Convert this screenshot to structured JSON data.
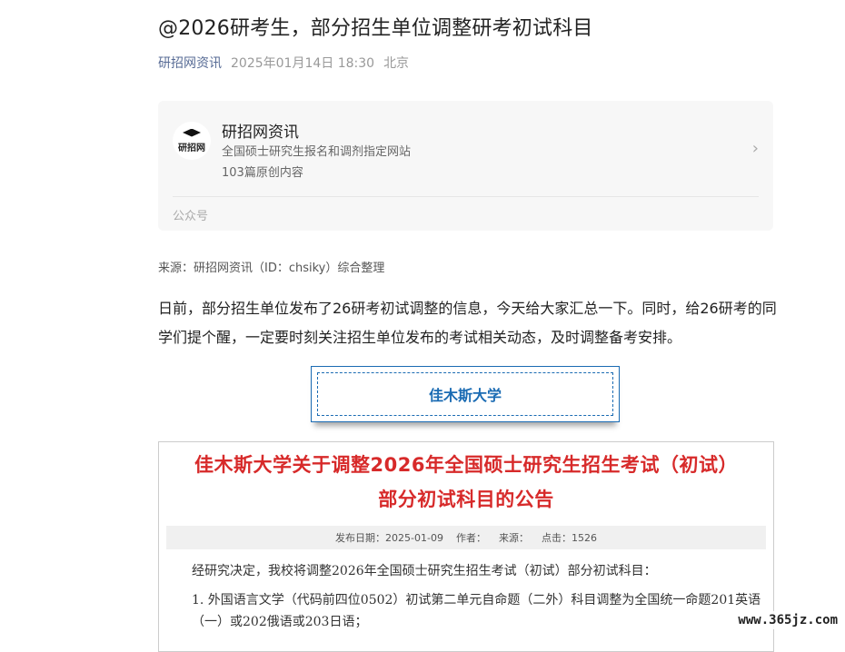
{
  "article": {
    "title": "@2026研考生，部分招生单位调整研考初试科目",
    "source_name": "研招网资讯",
    "datetime": "2025年01月14日 18:30",
    "location": "北京"
  },
  "account_card": {
    "avatar_text": "研招网",
    "name": "研招网资讯",
    "description": "全国硕士研究生报名和调剂指定网站",
    "article_count": "103篇原创内容",
    "type_label": "公众号"
  },
  "source_line": "来源：研招网资讯（ID：chsiky）综合整理",
  "intro_paragraph": "日前，部分招生单位发布了26研考初试调整的信息，今天给大家汇总一下。同时，给26研考的同学们提个醒，一定要时刻关注招生单位发布的考试相关动态，及时调整备考安排。",
  "university_heading": "佳木斯大学",
  "notice": {
    "title_line1": "佳木斯大学关于调整2026年全国硕士研究生招生考试（初试）",
    "title_line2": "部分初试科目的公告",
    "publish_date": "发布日期：2025-01-09",
    "author": "作者：",
    "source": "来源：",
    "clicks": "点击：1526",
    "body_p1": "经研究决定，我校将调整2026年全国硕士研究生招生考试（初试）部分初试科目：",
    "body_p2": "1. 外国语言文学（代码前四位0502）初试第二单元自命题（二外）科目调整为全国统一命题201英语（一）或202俄语或203日语；"
  },
  "watermark": "www.365jz.com"
}
